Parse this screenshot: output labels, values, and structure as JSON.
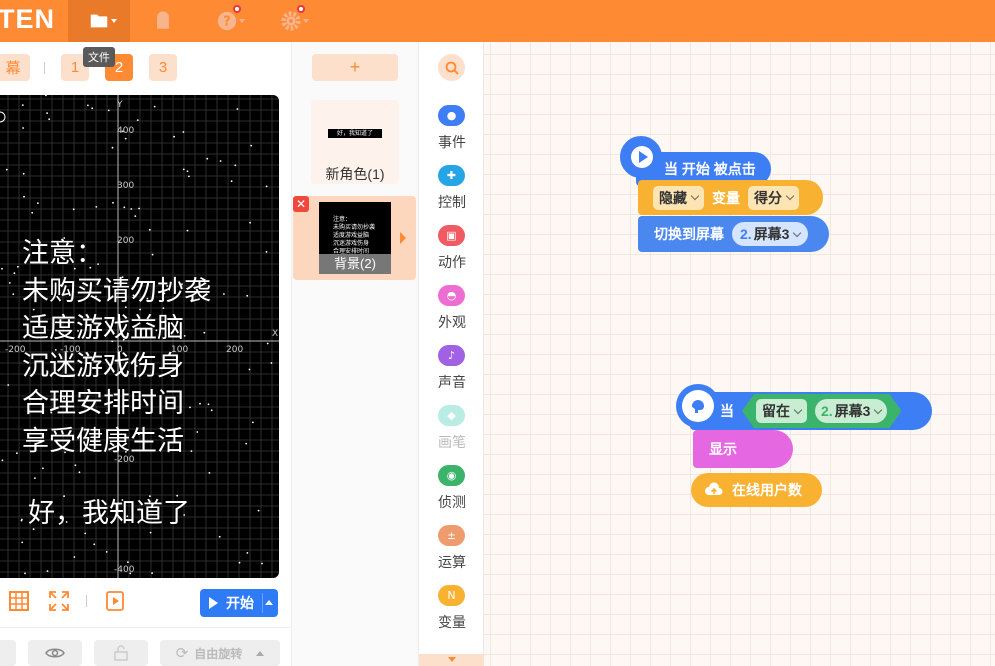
{
  "app": {
    "brand": "TEN"
  },
  "topbar": {
    "tooltip": "文件"
  },
  "screen_tabs": {
    "partial_label": "幕",
    "tabs": [
      "1",
      "2",
      "3"
    ],
    "active": "2"
  },
  "stage": {
    "text_lines": [
      "注意：",
      "未购买请勿抄袭",
      "适度游戏益脑",
      "沉迷游戏伤身",
      "合理安排时间",
      "享受健康生活"
    ],
    "confirm": "好，我知道了",
    "axis": {
      "y_label": "Y",
      "x_label": "X",
      "y_ticks": [
        "400",
        "300",
        "200",
        "-200",
        "-400"
      ],
      "x_ticks": [
        "-200",
        "-100",
        "0",
        "100",
        "200"
      ]
    }
  },
  "controls": {
    "start_label": "开始",
    "rotate_label": "自由旋转"
  },
  "sprites": {
    "add_label": "+",
    "items": [
      {
        "name": "新角色(1)",
        "thumb_text": "好，我知道了"
      }
    ],
    "background": {
      "name": "背景(2)",
      "thumb_lines": [
        "注意：",
        "未购买请勿抄袭",
        "适度游戏益脑",
        "沉迷游戏伤身",
        "合理安排时间"
      ]
    }
  },
  "categories": [
    {
      "label": "事件",
      "color": "#3d7ef5"
    },
    {
      "label": "控制",
      "color": "#26a5e6"
    },
    {
      "label": "动作",
      "color": "#ef5a63"
    },
    {
      "label": "外观",
      "color": "#ec6ed2"
    },
    {
      "label": "声音",
      "color": "#a061e5"
    },
    {
      "label": "画笔",
      "color": "#b9ece3",
      "muted": true
    },
    {
      "label": "侦测",
      "color": "#3bb36a"
    },
    {
      "label": "运算",
      "color": "#ee9c6e"
    },
    {
      "label": "变量",
      "color": "#f9b132"
    }
  ],
  "script1": {
    "hat": "当 开始 被点击",
    "hide": "隐藏",
    "var_word": "变量",
    "var_name": "得分",
    "switch": "切换到屏幕",
    "screen_num": "2.",
    "screen_name": "屏幕3"
  },
  "script2": {
    "when": "当",
    "stay": "留在",
    "screen_num": "2.",
    "screen_name": "屏幕3",
    "show": "显示",
    "online": "在线用户数"
  }
}
